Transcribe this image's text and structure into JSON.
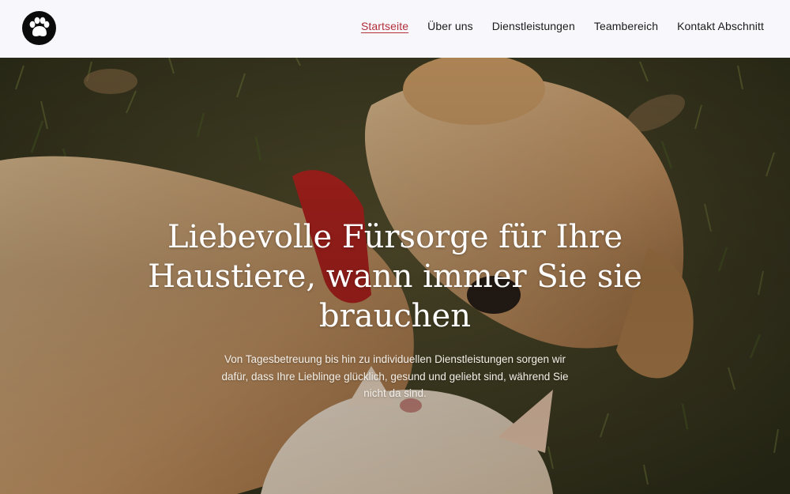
{
  "header": {
    "logo_icon": "paw-icon",
    "nav": [
      {
        "label": "Startseite",
        "active": true
      },
      {
        "label": "Über uns",
        "active": false
      },
      {
        "label": "Dienstleistungen",
        "active": false
      },
      {
        "label": "Teambereich",
        "active": false
      },
      {
        "label": "Kontakt Abschnitt",
        "active": false
      }
    ]
  },
  "hero": {
    "title": "Liebevolle Fürsorge für Ihre Haustiere, wann immer Sie sie brauchen",
    "subtitle": "Von Tagesbetreuung bis hin zu individuellen Dienstleistungen sorgen wir dafür, dass Ihre Lieblinge glücklich, gesund und geliebt sind, während Sie nicht da sind.",
    "image_subject": "puppy-and-kitten-on-grass"
  },
  "colors": {
    "accent": "#b1303a",
    "header_bg": "#f8f7fc",
    "text": "#1b1b1b"
  }
}
